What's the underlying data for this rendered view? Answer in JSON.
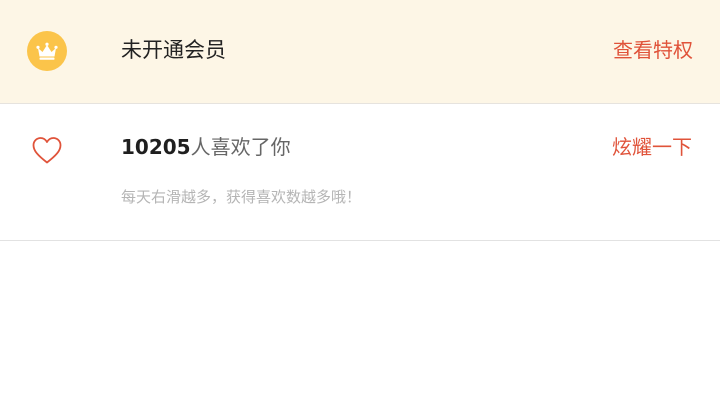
{
  "vip": {
    "status_label": "未开通会员",
    "action_label": "查看特权",
    "icon": "crown-icon",
    "badge_color": "#fbc44a",
    "background_color": "#fdf6e6"
  },
  "likes": {
    "count": "10205",
    "suffix": "人喜欢了你",
    "action_label": "炫耀一下",
    "hint": "每天右滑越多，获得喜欢数越多哦！",
    "icon": "heart-outline-icon"
  },
  "colors": {
    "accent": "#e0533a",
    "text_primary": "#222222",
    "text_hint": "#b5b5b5"
  }
}
